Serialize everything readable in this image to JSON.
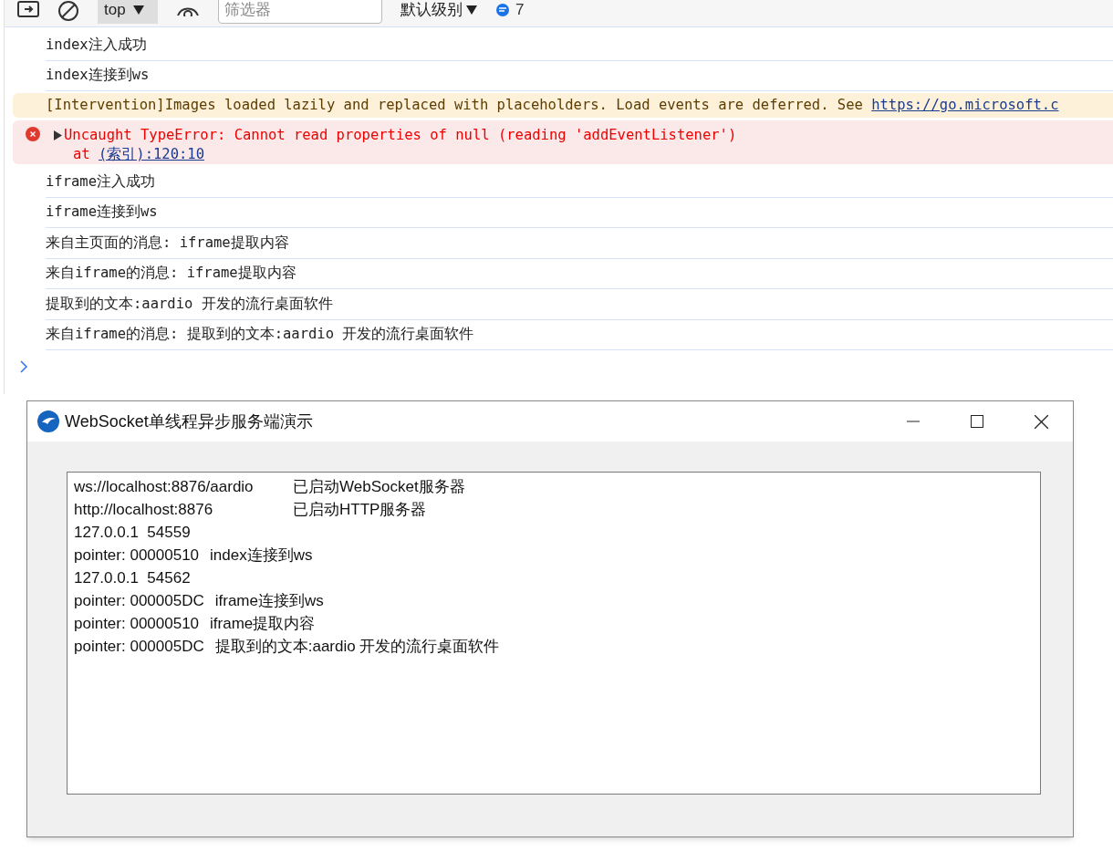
{
  "toolbar": {
    "context": "top",
    "filter": {
      "placeholder": "筛选器"
    },
    "level": "默认级别",
    "message_count": "7"
  },
  "console": [
    {
      "kind": "log",
      "text": "index注入成功"
    },
    {
      "kind": "log",
      "text": "index连接到ws"
    },
    {
      "kind": "warning",
      "text": "[Intervention]Images loaded lazily and replaced with placeholders. Load events are deferred. See ",
      "link": "https://go.microsoft.c"
    },
    {
      "kind": "error",
      "text": "Uncaught TypeError: Cannot read properties of null (reading 'addEventListener')",
      "expanded": false,
      "at": "at ",
      "link": "(索引):120:10"
    },
    {
      "kind": "log",
      "text": "iframe注入成功"
    },
    {
      "kind": "log",
      "text": "iframe连接到ws"
    },
    {
      "kind": "log",
      "text": "来自主页面的消息: iframe提取内容"
    },
    {
      "kind": "log",
      "text": "来自iframe的消息: iframe提取内容"
    },
    {
      "kind": "log",
      "text": "提取到的文本:aardio 开发的流行桌面软件"
    },
    {
      "kind": "log",
      "text": "来自iframe的消息: 提取到的文本:aardio 开发的流行桌面软件"
    }
  ],
  "window": {
    "title": "WebSocket单线程异步服务端演示",
    "lines": [
      {
        "kind": "tab",
        "text": "ws://localhost:8876/aardio",
        "message": "已启动WebSocket服务器"
      },
      {
        "kind": "tab",
        "text": "http://localhost:8876",
        "message": "已启动HTTP服务器"
      },
      {
        "kind": "plain",
        "text": "127.0.0.1  54559"
      },
      {
        "kind": "plain",
        "text": "pointer: 00000510",
        "message": "index连接到ws"
      },
      {
        "kind": "plain",
        "text": "127.0.0.1  54562"
      },
      {
        "kind": "plain",
        "text": "pointer: 000005DC",
        "message": "iframe连接到ws"
      },
      {
        "kind": "plain",
        "text": "pointer: 00000510",
        "message": "iframe提取内容"
      },
      {
        "kind": "plain",
        "text": "pointer: 000005DC",
        "message": "提取到的文本:aardio 开发的流行桌面软件"
      }
    ]
  }
}
